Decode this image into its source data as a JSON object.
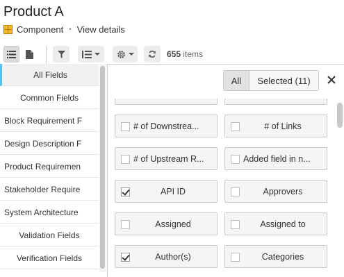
{
  "header": {
    "title": "Product A",
    "type_label": "Component",
    "view_details": "View details"
  },
  "toolbar": {
    "count_number": "655",
    "count_suffix": " items",
    "icons": [
      "list-view-icon",
      "document-view-icon",
      "filter-icon",
      "sort-icon",
      "gear-icon",
      "refresh-icon"
    ]
  },
  "left_list": {
    "items": [
      {
        "label": "All Fields",
        "selected": true
      },
      {
        "label": "Common Fields"
      },
      {
        "label": "Block Requirement F"
      },
      {
        "label": "Design Description F"
      },
      {
        "label": "Product Requiremen"
      },
      {
        "label": "Stakeholder Require"
      },
      {
        "label": "System Architecture"
      },
      {
        "label": "Validation Fields"
      },
      {
        "label": "Verification Fields"
      }
    ]
  },
  "popup": {
    "filter_all": "All",
    "filter_selected": "Selected (11)",
    "fields": [
      {
        "label": "",
        "checked": false
      },
      {
        "label": "",
        "checked": false
      },
      {
        "label": "# of Downstrea...",
        "checked": false
      },
      {
        "label": "# of Links",
        "checked": false
      },
      {
        "label": "# of Upstream R...",
        "checked": false
      },
      {
        "label": "Added field in n...",
        "checked": false
      },
      {
        "label": "API ID",
        "checked": true
      },
      {
        "label": "Approvers",
        "checked": false
      },
      {
        "label": "Assigned",
        "checked": false
      },
      {
        "label": "Assigned to",
        "checked": false
      },
      {
        "label": "Author(s)",
        "checked": true
      },
      {
        "label": "Categories",
        "checked": false
      }
    ]
  },
  "colors": {
    "accent": "#5bc0e8",
    "component_icon": "#f2b632"
  }
}
